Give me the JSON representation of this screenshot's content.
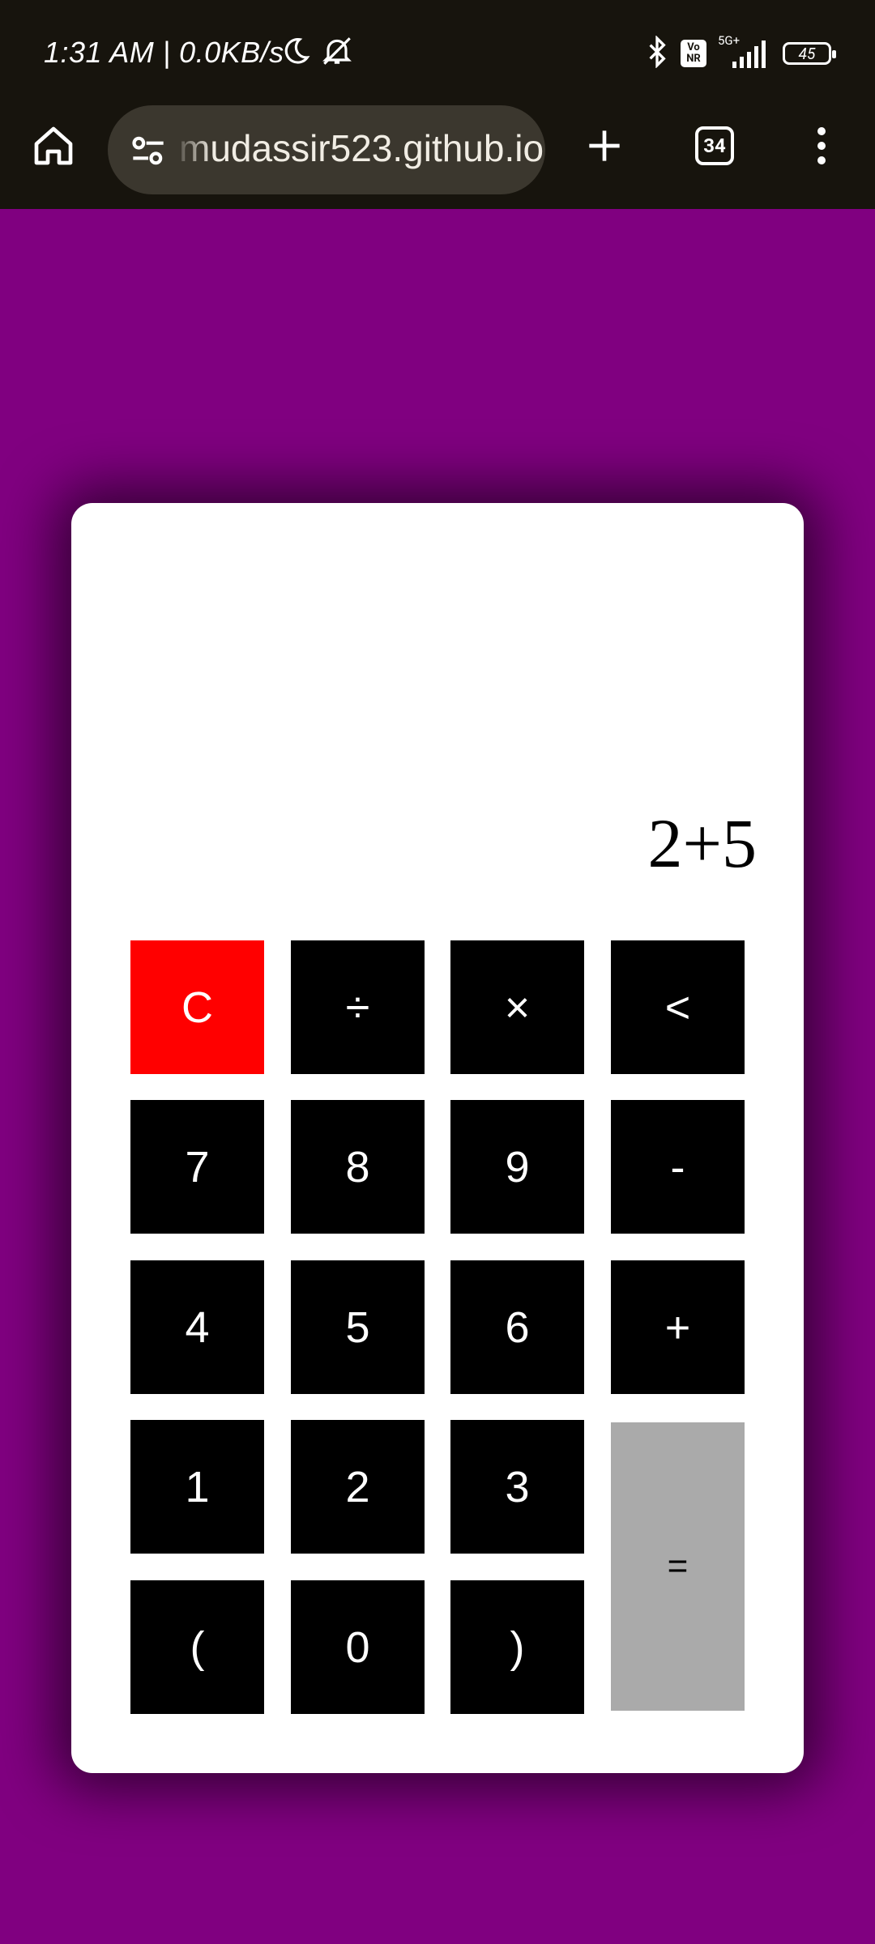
{
  "status_bar": {
    "time": "1:31 AM | 0.0KB/s",
    "network_label": "5G+",
    "vonr_label_top": "Vo",
    "vonr_label_bottom": "NR",
    "battery": "45",
    "icons": [
      "moon-icon",
      "bell-off-icon",
      "bluetooth-icon",
      "signal-icon",
      "battery-icon"
    ]
  },
  "browser": {
    "url": "mudassir523.github.io",
    "tab_count": "34",
    "icons": [
      "home-icon",
      "tune-icon",
      "plus-icon",
      "more-vert-icon"
    ]
  },
  "calculator": {
    "display": "2+5",
    "colors": {
      "page_background": "#800080",
      "key": "#000000",
      "clear_key": "#ff0000",
      "equals_key": "#aaaaaa"
    },
    "keys": {
      "clear": "C",
      "divide": "÷",
      "multiply": "×",
      "backspace": "<",
      "seven": "7",
      "eight": "8",
      "nine": "9",
      "minus": "-",
      "four": "4",
      "five": "5",
      "six": "6",
      "plus": "+",
      "one": "1",
      "two": "2",
      "three": "3",
      "equals": "=",
      "open_paren": "(",
      "zero": "0",
      "close_paren": ")"
    }
  }
}
